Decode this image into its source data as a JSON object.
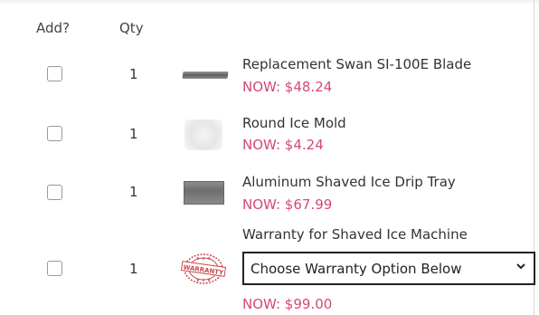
{
  "columns": {
    "add": "Add?",
    "qty": "Qty"
  },
  "items": [
    {
      "qty": "1",
      "title": "Replacement Swan SI-100E Blade",
      "price": "NOW: $48.24",
      "image": "blade-thumbnail"
    },
    {
      "qty": "1",
      "title": "Round Ice Mold",
      "price": "NOW: $4.24",
      "image": "ice-mold-thumbnail"
    },
    {
      "qty": "1",
      "title": "Aluminum Shaved Ice Drip Tray",
      "price": "NOW: $67.99",
      "image": "drip-tray-thumbnail"
    },
    {
      "qty": "1",
      "title": "Warranty for Shaved Ice Machine",
      "price": "NOW: $99.00",
      "image": "warranty-stamp",
      "select_value": "Choose Warranty Option Below",
      "stamp_text": "WARRANTY"
    }
  ],
  "colors": {
    "price": "#d24a72",
    "text": "#333333",
    "checkbox_border": "#9a9a9a",
    "stamp": "#c8484a"
  }
}
